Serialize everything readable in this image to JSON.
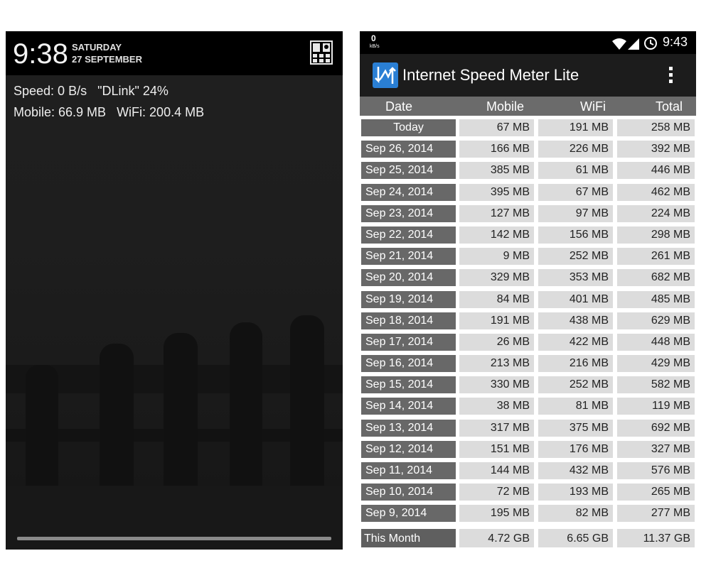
{
  "lock_screen": {
    "time": "9:38",
    "day": "SATURDAY",
    "date": "27 SEPTEMBER",
    "speed_line": "Speed: 0 B/s   \"DLink\" 24%",
    "usage_line": "Mobile: 66.9 MB   WiFi: 200.4 MB",
    "quick_settings_icon": "quick-settings-icon"
  },
  "status_bar": {
    "speed_value": "0",
    "speed_unit": "kB/s",
    "time": "9:43",
    "icons": [
      "wifi-icon",
      "signal-icon",
      "alarm-icon"
    ]
  },
  "app": {
    "title": "Internet Speed Meter Lite",
    "icon": "speed-arrows-icon",
    "menu_icon": "overflow-menu-icon",
    "accent_color": "#2a7fd4"
  },
  "table": {
    "columns": [
      "Date",
      "Mobile",
      "WiFi",
      "Total"
    ],
    "rows": [
      {
        "date": "Today",
        "mobile": "67 MB",
        "wifi": "191 MB",
        "total": "258 MB"
      },
      {
        "date": "Sep 26, 2014",
        "mobile": "166 MB",
        "wifi": "226 MB",
        "total": "392 MB"
      },
      {
        "date": "Sep 25, 2014",
        "mobile": "385 MB",
        "wifi": "61 MB",
        "total": "446 MB"
      },
      {
        "date": "Sep 24, 2014",
        "mobile": "395 MB",
        "wifi": "67 MB",
        "total": "462 MB"
      },
      {
        "date": "Sep 23, 2014",
        "mobile": "127 MB",
        "wifi": "97 MB",
        "total": "224 MB"
      },
      {
        "date": "Sep 22, 2014",
        "mobile": "142 MB",
        "wifi": "156 MB",
        "total": "298 MB"
      },
      {
        "date": "Sep 21, 2014",
        "mobile": "9 MB",
        "wifi": "252 MB",
        "total": "261 MB"
      },
      {
        "date": "Sep 20, 2014",
        "mobile": "329 MB",
        "wifi": "353 MB",
        "total": "682 MB"
      },
      {
        "date": "Sep 19, 2014",
        "mobile": "84 MB",
        "wifi": "401 MB",
        "total": "485 MB"
      },
      {
        "date": "Sep 18, 2014",
        "mobile": "191 MB",
        "wifi": "438 MB",
        "total": "629 MB"
      },
      {
        "date": "Sep 17, 2014",
        "mobile": "26 MB",
        "wifi": "422 MB",
        "total": "448 MB"
      },
      {
        "date": "Sep 16, 2014",
        "mobile": "213 MB",
        "wifi": "216 MB",
        "total": "429 MB"
      },
      {
        "date": "Sep 15, 2014",
        "mobile": "330 MB",
        "wifi": "252 MB",
        "total": "582 MB"
      },
      {
        "date": "Sep 14, 2014",
        "mobile": "38 MB",
        "wifi": "81 MB",
        "total": "119 MB"
      },
      {
        "date": "Sep 13, 2014",
        "mobile": "317 MB",
        "wifi": "375 MB",
        "total": "692 MB"
      },
      {
        "date": "Sep 12, 2014",
        "mobile": "151 MB",
        "wifi": "176 MB",
        "total": "327 MB"
      },
      {
        "date": "Sep 11, 2014",
        "mobile": "144 MB",
        "wifi": "432 MB",
        "total": "576 MB"
      },
      {
        "date": "Sep 10, 2014",
        "mobile": "72 MB",
        "wifi": "193 MB",
        "total": "265 MB"
      },
      {
        "date": "Sep 9, 2014",
        "mobile": "195 MB",
        "wifi": "82 MB",
        "total": "277 MB"
      }
    ],
    "summary": {
      "date": "This Month",
      "mobile": "4.72 GB",
      "wifi": "6.65 GB",
      "total": "11.37 GB"
    }
  }
}
